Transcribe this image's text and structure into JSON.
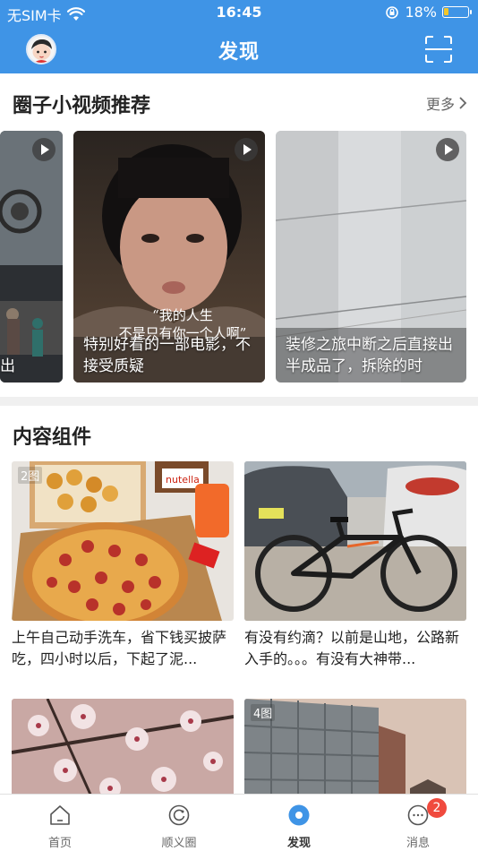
{
  "status_bar": {
    "carrier": "无SIM卡",
    "time": "16:45",
    "battery": "18%",
    "battery_level": 0.18
  },
  "header": {
    "title": "发现"
  },
  "video_section": {
    "title": "圈子小视频推荐",
    "more_label": "更多",
    "cards": [
      {
        "caption": "出"
      },
      {
        "subtitle_line1": "“我的人生",
        "subtitle_line2": "不是只有你一个人啊”",
        "caption": "特别好看的一部电影，不接受质疑"
      },
      {
        "caption": "装修之旅中断之后直接出半成品了，拆除的时"
      }
    ]
  },
  "content_section": {
    "title": "内容组件",
    "posts": [
      {
        "badge": "2图",
        "text": "上午自己动手洗车，省下钱买披萨吃，四小时以后，下起了泥..."
      },
      {
        "badge": "",
        "text": "有没有约滴？以前是山地，公路新入手的。。。有没有大神带..."
      },
      {
        "badge": "",
        "text": ""
      },
      {
        "badge": "4图",
        "text": ""
      }
    ]
  },
  "tabbar": {
    "tabs": [
      {
        "label": "首页"
      },
      {
        "label": "顺义圈"
      },
      {
        "label": "发现"
      },
      {
        "label": "消息",
        "badge": "2"
      }
    ]
  },
  "colors": {
    "header_bg": "#3f94e6",
    "active_tab": "#3f94e6",
    "badge_red": "#f04a3e"
  }
}
